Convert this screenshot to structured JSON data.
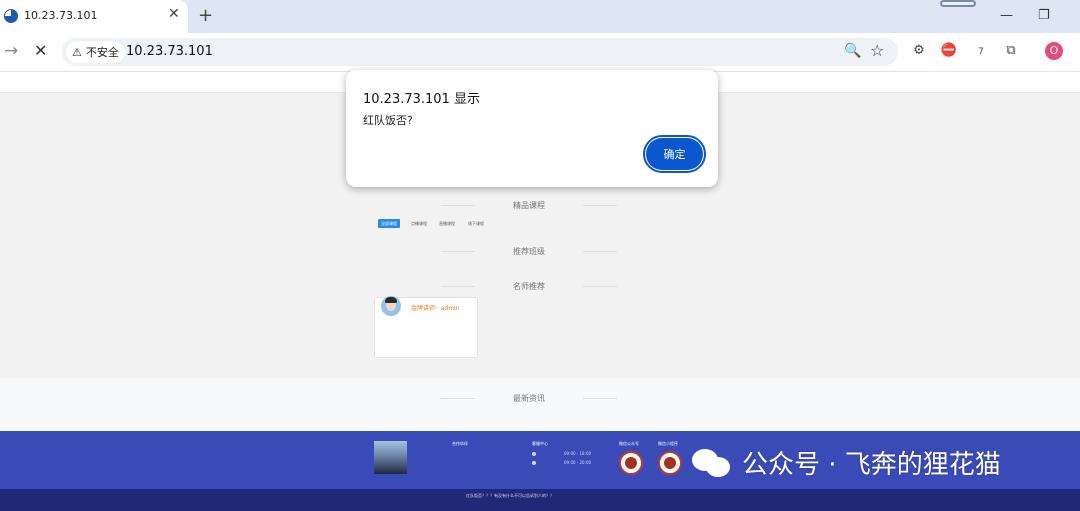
{
  "browser": {
    "tab_title": "10.23.73.101",
    "new_tab": "+",
    "security_label": "不安全",
    "url": "10.23.73.101",
    "profile_initial": "O",
    "extension_badge": "7"
  },
  "page": {
    "sections": {
      "courses": "精品课程",
      "classes": "推荐班级",
      "teachers": "名师推荐",
      "news": "最新资讯"
    },
    "course_filters": [
      "全部课程",
      "点播课程",
      "直播课程",
      "线下课程"
    ],
    "teacher_card": {
      "name": "金牌讲师 · admin"
    },
    "footer": {
      "partners": "合作伙伴",
      "service": "客服中心",
      "service_lines": [
        "09:00 - 18:00",
        "09:00 - 20:00"
      ],
      "wechat_official": "微信公众号",
      "mini_program": "微信小程序",
      "copyright": "红队饭否？？？有没有什么不可以告诉别人的？？"
    }
  },
  "dialog": {
    "title": "10.23.73.101 显示",
    "message": "红队饭否?",
    "ok_label": "确定"
  },
  "watermark": {
    "text": "公众号 · 飞奔的狸花猫"
  }
}
